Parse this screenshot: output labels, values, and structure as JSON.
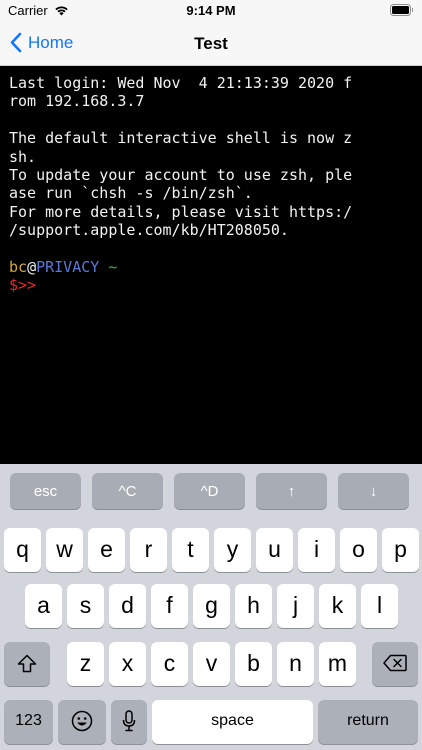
{
  "status_bar": {
    "carrier": "Carrier",
    "time": "9:14 PM"
  },
  "nav": {
    "back_label": "Home",
    "title": "Test"
  },
  "terminal": {
    "lines": [
      "Last login: Wed Nov  4 21:13:39 2020 f",
      "rom 192.168.3.7",
      "",
      "The default interactive shell is now z",
      "sh.",
      "To update your account to use zsh, ple",
      "ase run `chsh -s /bin/zsh`.",
      "For more details, please visit https:/",
      "/support.apple.com/kb/HT208050.",
      ""
    ],
    "prompt": {
      "user": "bc",
      "at": "@",
      "host": "PRIVACY",
      "tilde": "~",
      "symbol": "$>>"
    },
    "colors": {
      "user": "#d3a733",
      "host": "#5a78d8",
      "tilde": "#3fb44b",
      "prompt": "#e32b2b"
    }
  },
  "keyboard": {
    "toolbar": [
      "esc",
      "^C",
      "^D",
      "↑",
      "↓"
    ],
    "row1": [
      "q",
      "w",
      "e",
      "r",
      "t",
      "y",
      "u",
      "i",
      "o",
      "p"
    ],
    "row2": [
      "a",
      "s",
      "d",
      "f",
      "g",
      "h",
      "j",
      "k",
      "l"
    ],
    "row3": [
      "z",
      "x",
      "c",
      "v",
      "b",
      "n",
      "m"
    ],
    "numbers_label": "123",
    "space_label": "space",
    "return_label": "return"
  },
  "accent_color": "#1676f3"
}
